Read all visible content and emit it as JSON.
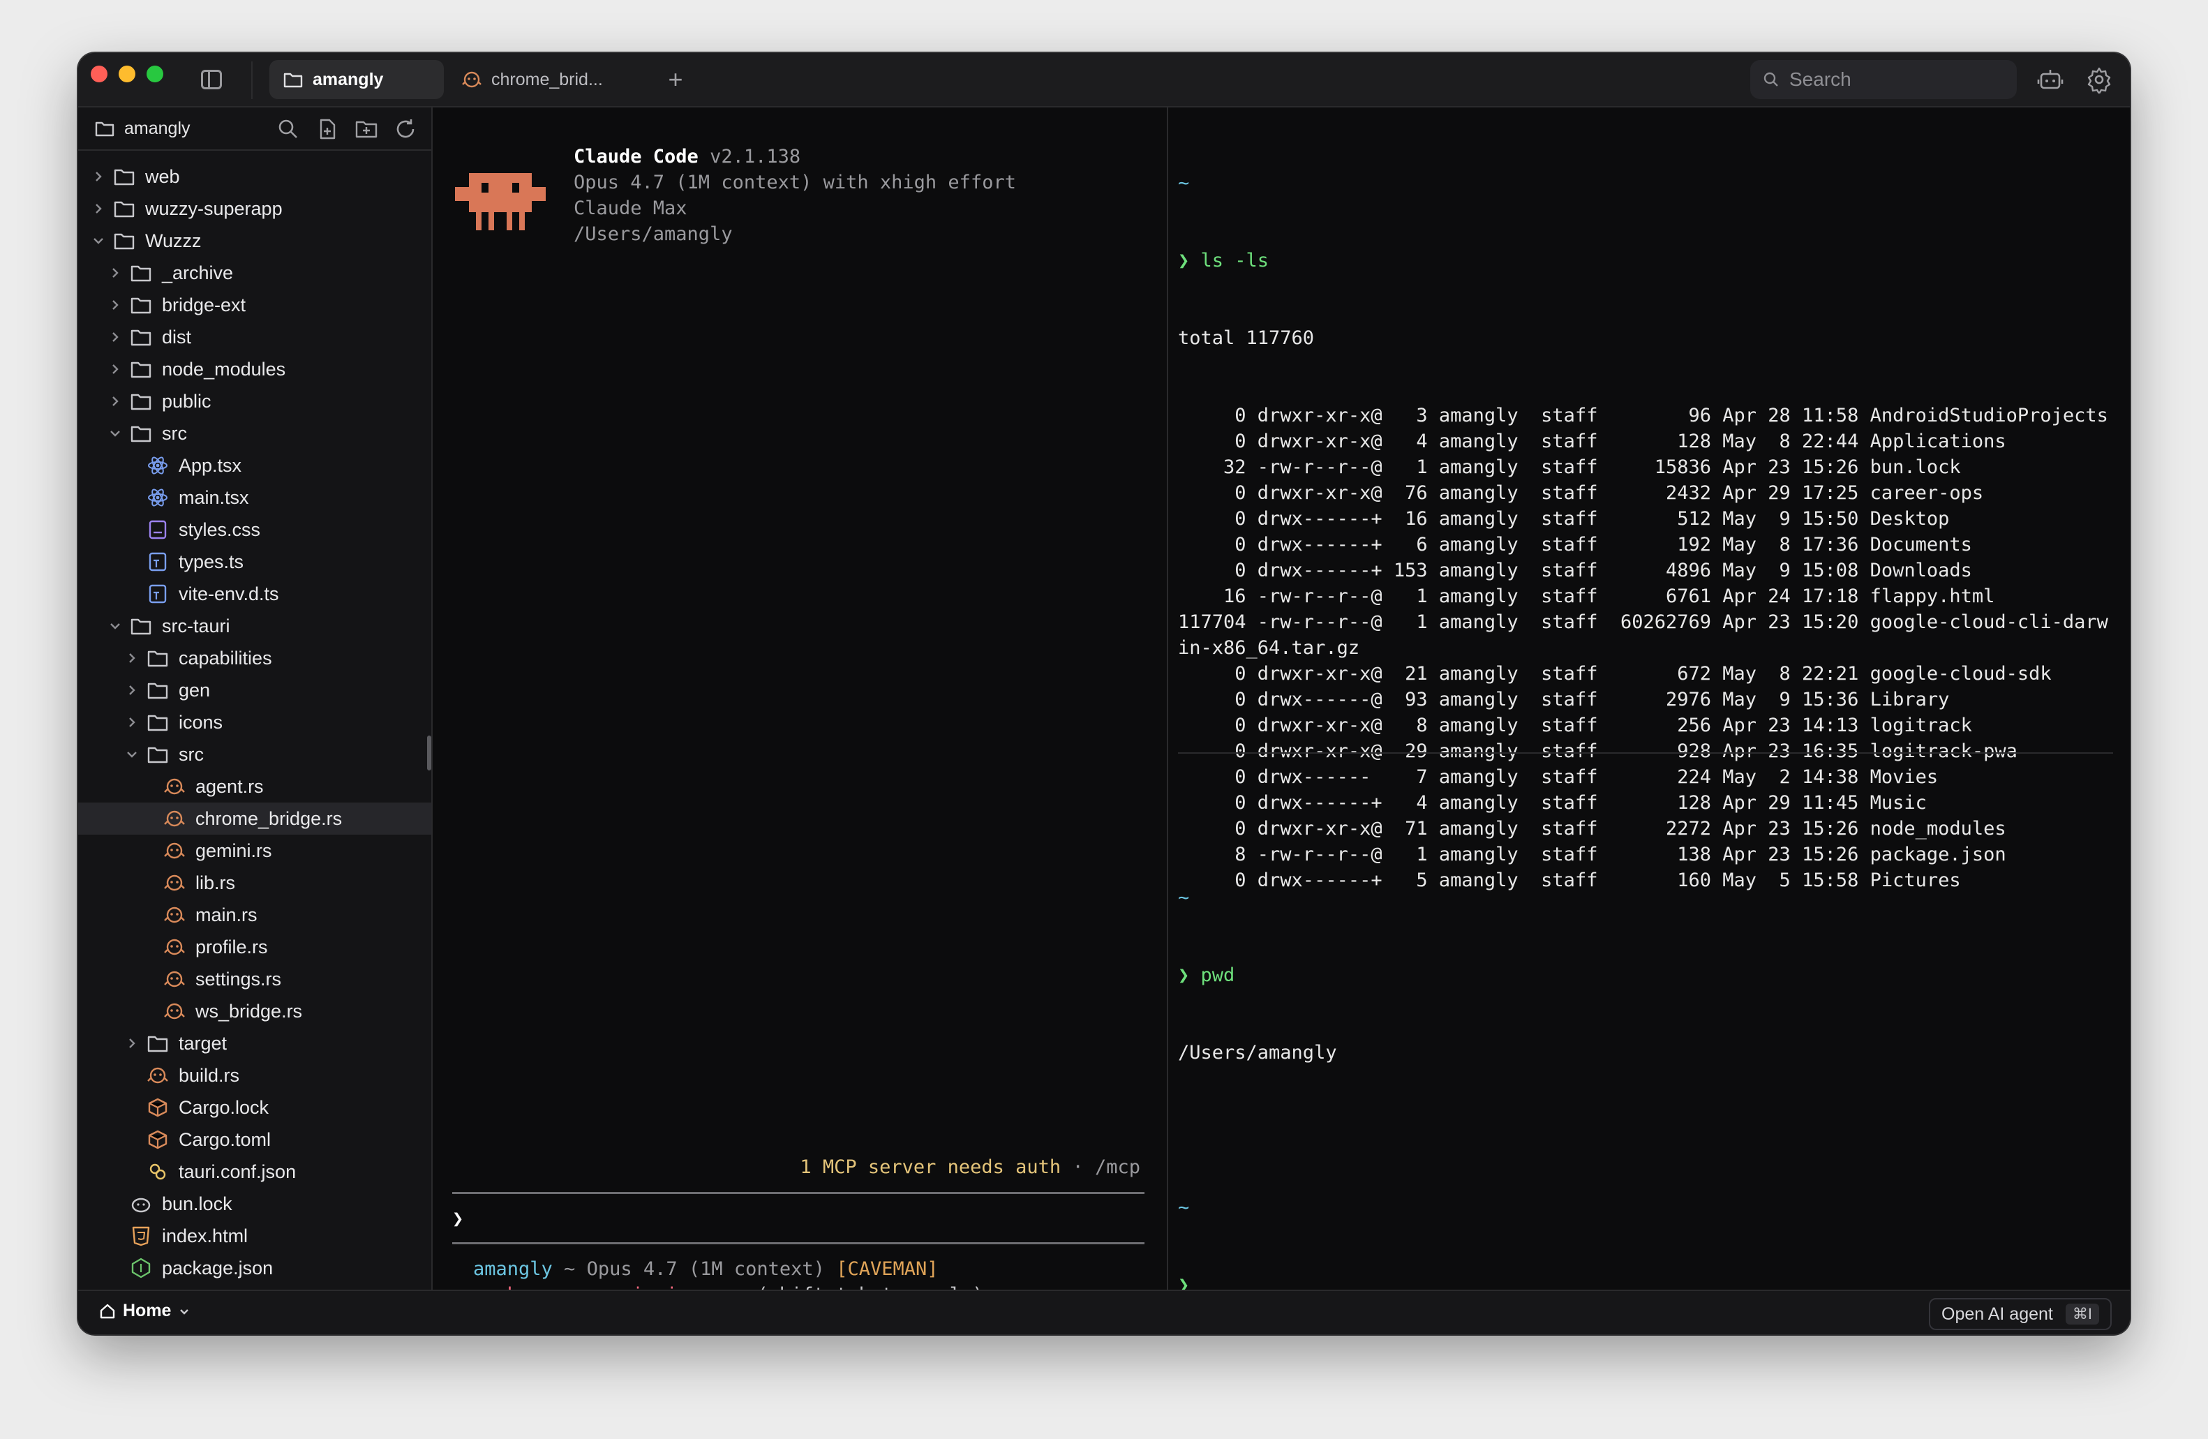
{
  "tabs": [
    {
      "label": "amangly",
      "icon": "folder-icon",
      "active": true
    },
    {
      "label": "chrome_brid...",
      "icon": "rust-icon",
      "active": false
    }
  ],
  "search": {
    "placeholder": "Search"
  },
  "sidebar": {
    "root": "amangly",
    "items": [
      {
        "label": "web",
        "depth": 0,
        "type": "folder",
        "expanded": false
      },
      {
        "label": "wuzzy-superapp",
        "depth": 0,
        "type": "folder",
        "expanded": false
      },
      {
        "label": "Wuzzz",
        "depth": 0,
        "type": "folder",
        "expanded": true
      },
      {
        "label": "_archive",
        "depth": 1,
        "type": "folder",
        "expanded": false
      },
      {
        "label": "bridge-ext",
        "depth": 1,
        "type": "folder",
        "expanded": false
      },
      {
        "label": "dist",
        "depth": 1,
        "type": "folder",
        "expanded": false
      },
      {
        "label": "node_modules",
        "depth": 1,
        "type": "folder",
        "expanded": false
      },
      {
        "label": "public",
        "depth": 1,
        "type": "folder",
        "expanded": false
      },
      {
        "label": "src",
        "depth": 1,
        "type": "folder",
        "expanded": true
      },
      {
        "label": "App.tsx",
        "depth": 2,
        "type": "react"
      },
      {
        "label": "main.tsx",
        "depth": 2,
        "type": "react"
      },
      {
        "label": "styles.css",
        "depth": 2,
        "type": "css"
      },
      {
        "label": "types.ts",
        "depth": 2,
        "type": "ts"
      },
      {
        "label": "vite-env.d.ts",
        "depth": 2,
        "type": "ts"
      },
      {
        "label": "src-tauri",
        "depth": 1,
        "type": "folder",
        "expanded": true
      },
      {
        "label": "capabilities",
        "depth": 2,
        "type": "folder",
        "expanded": false
      },
      {
        "label": "gen",
        "depth": 2,
        "type": "folder",
        "expanded": false
      },
      {
        "label": "icons",
        "depth": 2,
        "type": "folder",
        "expanded": false
      },
      {
        "label": "src",
        "depth": 2,
        "type": "folder",
        "expanded": true
      },
      {
        "label": "agent.rs",
        "depth": 3,
        "type": "rust"
      },
      {
        "label": "chrome_bridge.rs",
        "depth": 3,
        "type": "rust",
        "selected": true
      },
      {
        "label": "gemini.rs",
        "depth": 3,
        "type": "rust"
      },
      {
        "label": "lib.rs",
        "depth": 3,
        "type": "rust"
      },
      {
        "label": "main.rs",
        "depth": 3,
        "type": "rust"
      },
      {
        "label": "profile.rs",
        "depth": 3,
        "type": "rust"
      },
      {
        "label": "settings.rs",
        "depth": 3,
        "type": "rust"
      },
      {
        "label": "ws_bridge.rs",
        "depth": 3,
        "type": "rust"
      },
      {
        "label": "target",
        "depth": 2,
        "type": "folder",
        "expanded": false
      },
      {
        "label": "build.rs",
        "depth": 2,
        "type": "rust"
      },
      {
        "label": "Cargo.lock",
        "depth": 2,
        "type": "cargo"
      },
      {
        "label": "Cargo.toml",
        "depth": 2,
        "type": "cargo"
      },
      {
        "label": "tauri.conf.json",
        "depth": 2,
        "type": "tauri"
      },
      {
        "label": "bun.lock",
        "depth": 1,
        "type": "bun"
      },
      {
        "label": "index.html",
        "depth": 1,
        "type": "html"
      },
      {
        "label": "package.json",
        "depth": 1,
        "type": "node"
      }
    ]
  },
  "claude": {
    "name": "Claude Code",
    "version": "v2.1.138",
    "model_line": "Opus 4.7 (1M context) with xhigh effort",
    "plan": "Claude Max",
    "cwd": "/Users/amangly",
    "mcp_note": "1 MCP server needs auth",
    "mcp_sep": " · ",
    "mcp_cmd": "/mcp",
    "prompt": "❯",
    "status_user": "amangly",
    "status_sep": " ~ ",
    "status_model": "Opus 4.7 (1M context) ",
    "status_tag": "[CAVEMAN]",
    "perm_arrows": "▸▸ ",
    "perm_text": "bypass permissions on",
    "perm_hint": " (shift+tab to cycle)"
  },
  "terminal": {
    "tilde": "~",
    "prompt": "❯ ",
    "cmd1": "ls -ls",
    "total": "total 117760",
    "rows": [
      "     0 drwxr-xr-x@   3 amangly  staff        96 Apr 28 11:58 AndroidStudioProjects",
      "     0 drwxr-xr-x@   4 amangly  staff       128 May  8 22:44 Applications",
      "    32 -rw-r--r--@   1 amangly  staff     15836 Apr 23 15:26 bun.lock",
      "     0 drwxr-xr-x@  76 amangly  staff      2432 Apr 29 17:25 career-ops",
      "     0 drwx------+  16 amangly  staff       512 May  9 15:50 Desktop",
      "     0 drwx------+   6 amangly  staff       192 May  8 17:36 Documents",
      "     0 drwx------+ 153 amangly  staff      4896 May  9 15:08 Downloads",
      "    16 -rw-r--r--@   1 amangly  staff      6761 Apr 24 17:18 flappy.html",
      "117704 -rw-r--r--@   1 amangly  staff  60262769 Apr 23 15:20 google-cloud-cli-darw",
      "in-x86_64.tar.gz",
      "     0 drwxr-xr-x@  21 amangly  staff       672 May  8 22:21 google-cloud-sdk",
      "     0 drwx------@  93 amangly  staff      2976 May  9 15:36 Library",
      "     0 drwxr-xr-x@   8 amangly  staff       256 Apr 23 14:13 logitrack",
      "     0 drwxr-xr-x@  29 amangly  staff       928 Apr 23 16:35 logitrack-pwa",
      "     0 drwx------    7 amangly  staff       224 May  2 14:38 Movies",
      "     0 drwx------+   4 amangly  staff       128 Apr 29 11:45 Music",
      "     0 drwxr-xr-x@  71 amangly  staff      2272 Apr 23 15:26 node_modules",
      "     8 -rw-r--r--@   1 amangly  staff       138 Apr 23 15:26 package.json",
      "     0 drwx------+   5 amangly  staff       160 May  5 15:58 Pictures"
    ],
    "cmd2": "pwd",
    "pwd_out": "/Users/amangly",
    "final_prompt": "❯"
  },
  "bottombar": {
    "home_label": "Home",
    "ai_label": "Open AI agent",
    "ai_shortcut": "⌘I"
  },
  "colors": {
    "accent_cyan": "#6cc6e2",
    "prompt_green": "#6ee07c",
    "mcp_yellow": "#e4c47a",
    "bypass_red": "#ff6b81",
    "caveman_orange": "#e0a458",
    "mascot": "#d97757",
    "rust_icon": "#d98a5a"
  }
}
